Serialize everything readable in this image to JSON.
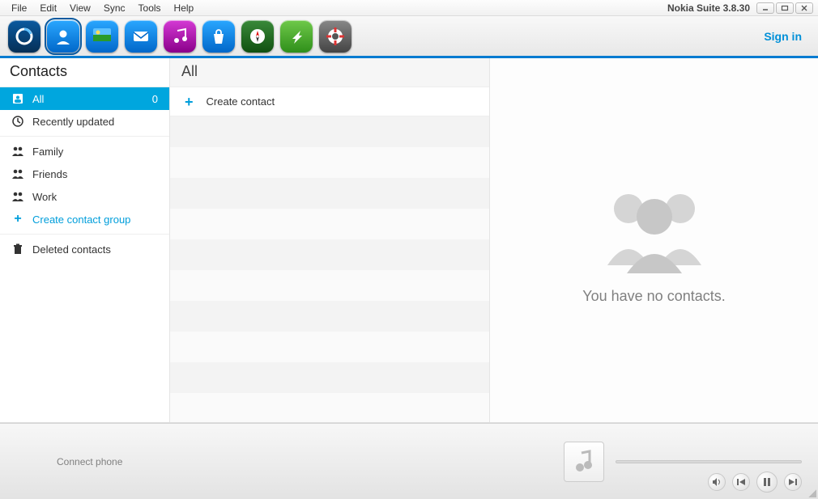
{
  "app": {
    "title": "Nokia Suite 3.8.30",
    "sign_in": "Sign in"
  },
  "menu": {
    "file": "File",
    "edit": "Edit",
    "view": "View",
    "sync": "Sync",
    "tools": "Tools",
    "help": "Help"
  },
  "toolbar_icons": {
    "home": "home-icon",
    "contacts": "contacts-icon",
    "gallery": "gallery-icon",
    "messaging": "messaging-icon",
    "music": "music-icon",
    "store": "store-icon",
    "maps": "maps-icon",
    "update": "update-icon",
    "support": "support-icon"
  },
  "sidebar": {
    "header": "Contacts",
    "all": {
      "label": "All",
      "count": "0"
    },
    "recent": {
      "label": "Recently updated"
    },
    "family": {
      "label": "Family"
    },
    "friends": {
      "label": "Friends"
    },
    "work": {
      "label": "Work"
    },
    "create_group": {
      "label": "Create contact group"
    },
    "deleted": {
      "label": "Deleted contacts"
    }
  },
  "mid": {
    "header": "All",
    "create": "Create contact"
  },
  "detail": {
    "empty_msg": "You have no contacts."
  },
  "footer": {
    "connect": "Connect phone"
  }
}
